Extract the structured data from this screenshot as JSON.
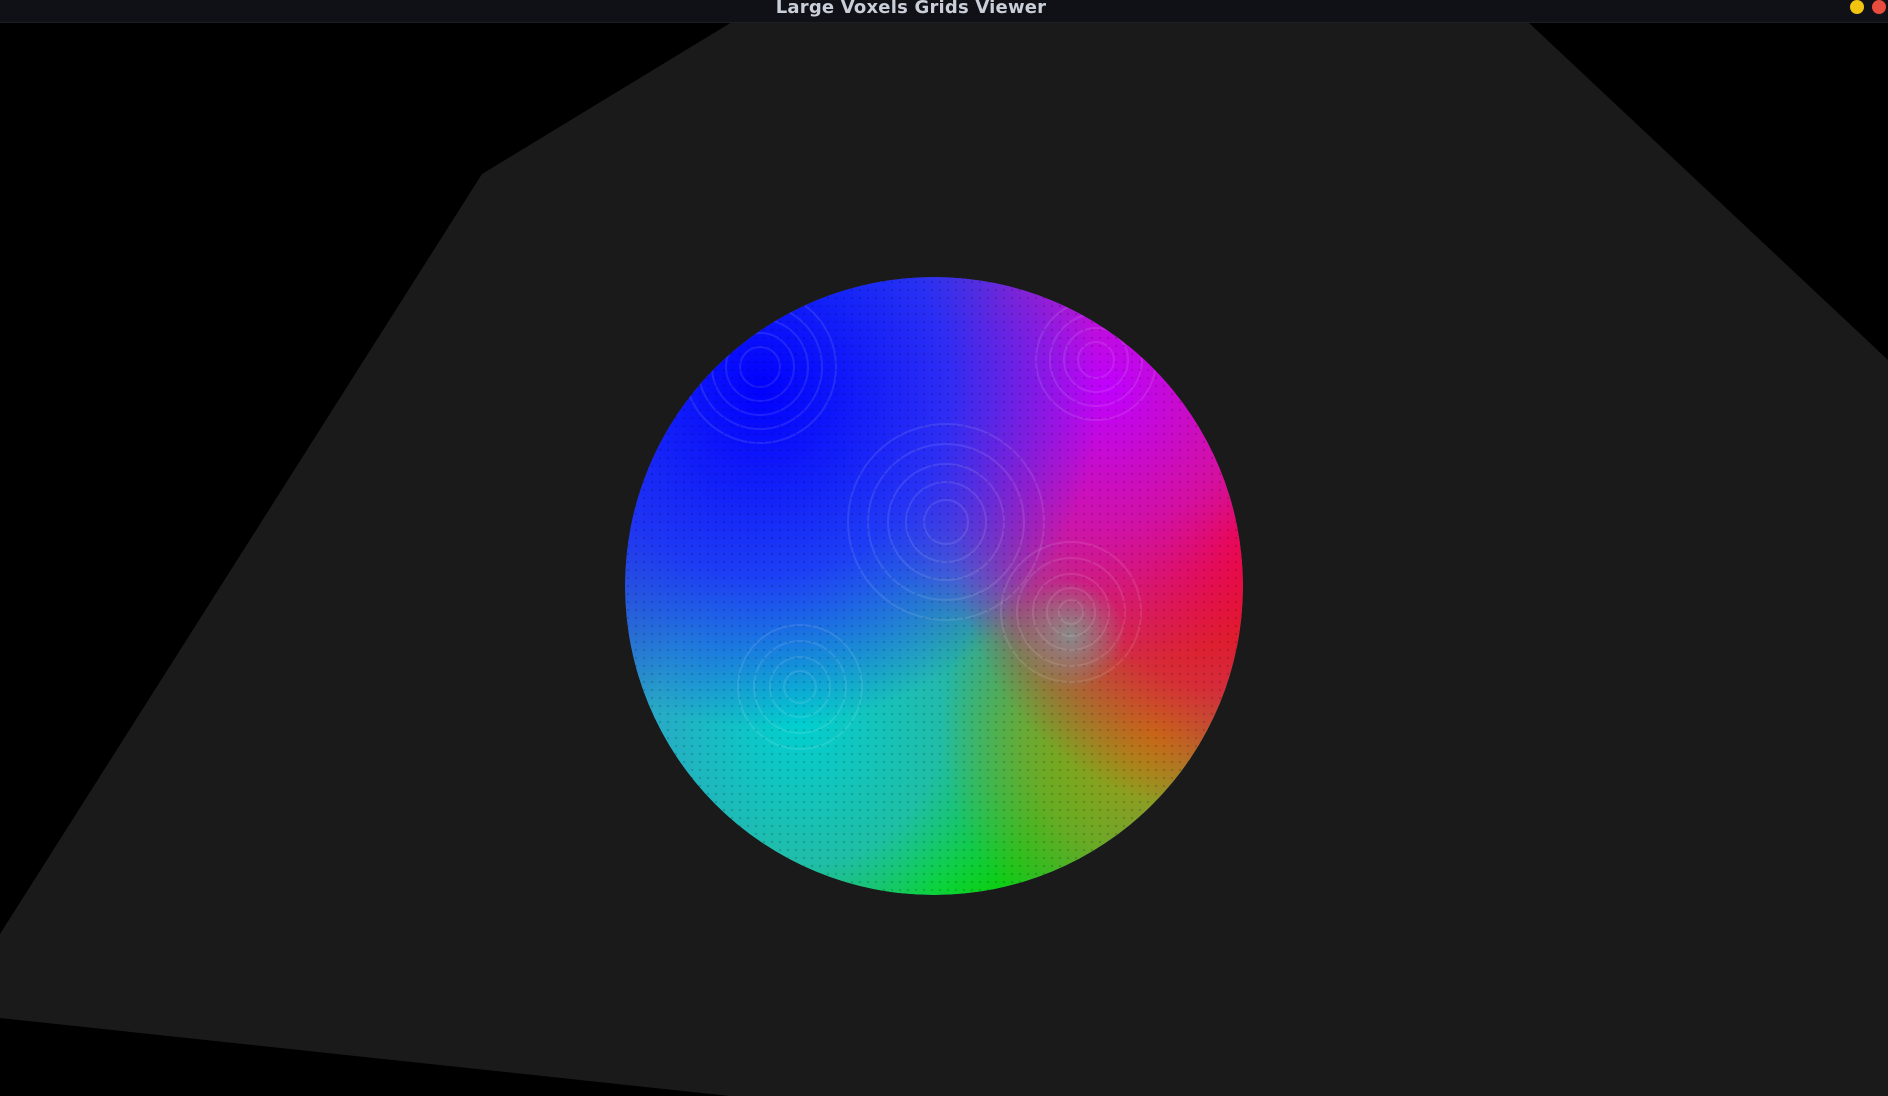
{
  "window": {
    "title": "Large Voxels Grids Viewer",
    "controls": {
      "minimize_color": "#f1c40f",
      "close_color": "#e74c3c"
    }
  },
  "viewport": {
    "background_color": "#000000",
    "floor_color": "#1a1a1a",
    "object": "voxel-sphere",
    "sphere_color_map": [
      "#0000ff",
      "#ff00ff",
      "#ff0000",
      "#00ffff",
      "#00ff00",
      "#ffff00",
      "#808080"
    ]
  }
}
